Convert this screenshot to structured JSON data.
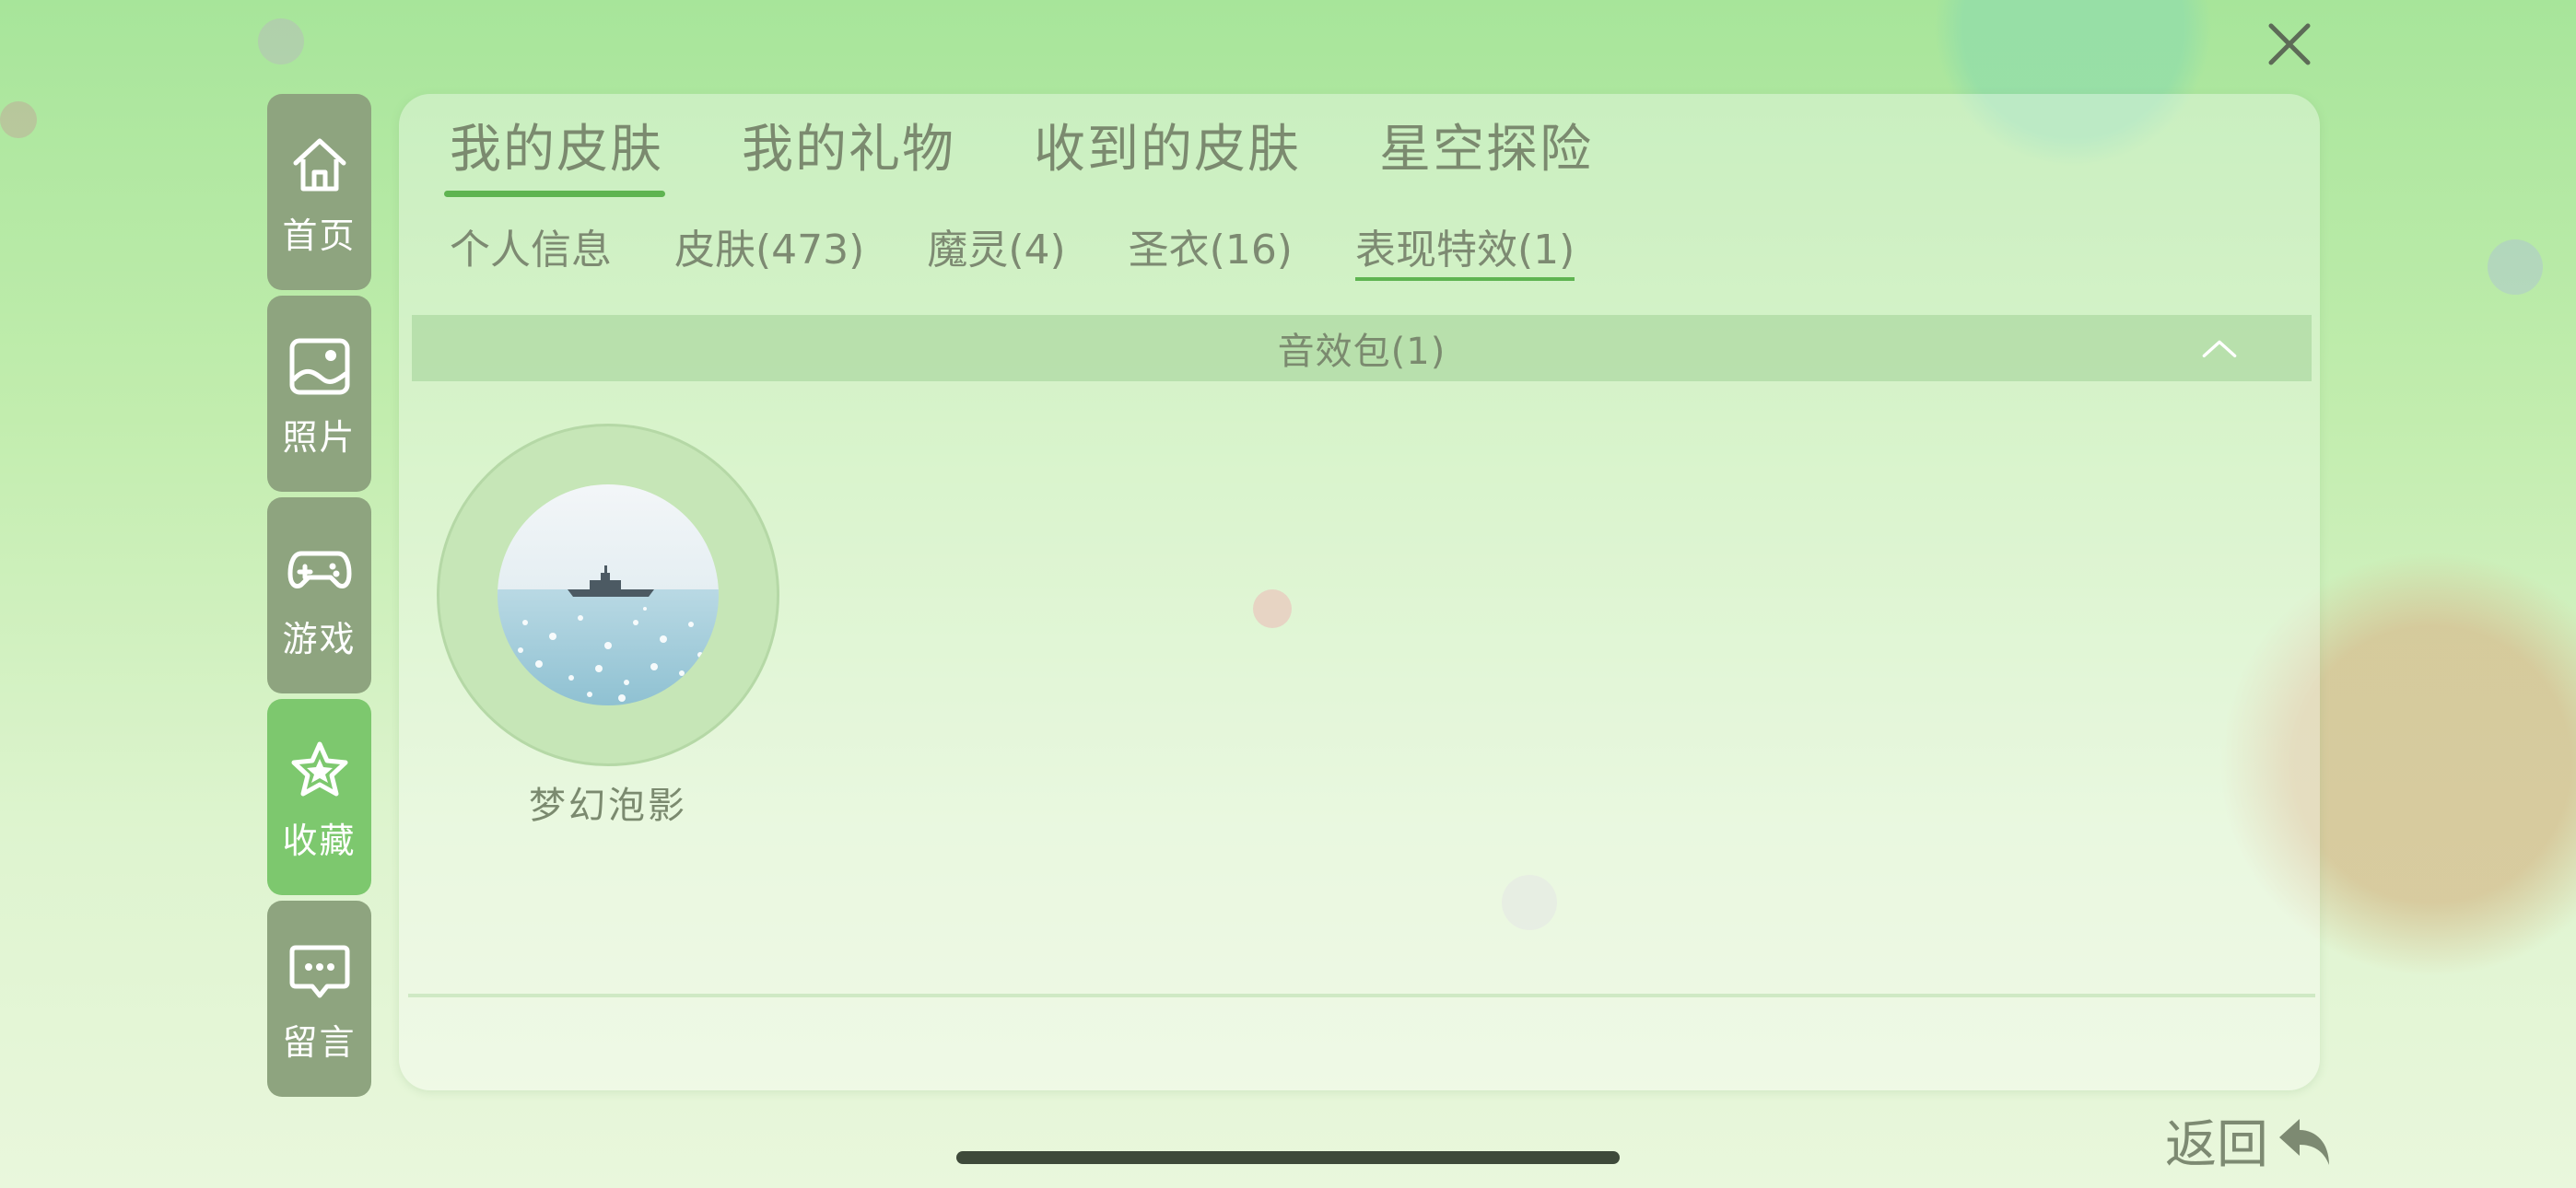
{
  "sidebar": {
    "items": [
      {
        "label": "首页",
        "icon": "home-icon"
      },
      {
        "label": "照片",
        "icon": "image-icon"
      },
      {
        "label": "游戏",
        "icon": "gamepad-icon"
      },
      {
        "label": "收藏",
        "icon": "star-icon",
        "active": true
      },
      {
        "label": "留言",
        "icon": "message-icon"
      }
    ]
  },
  "main_tabs": [
    {
      "label": "我的皮肤",
      "active": true
    },
    {
      "label": "我的礼物"
    },
    {
      "label": "收到的皮肤"
    },
    {
      "label": "星空探险"
    }
  ],
  "sub_tabs": [
    {
      "label": "个人信息"
    },
    {
      "label": "皮肤(473)"
    },
    {
      "label": "魔灵(4)"
    },
    {
      "label": "圣衣(16)"
    },
    {
      "label": "表现特效(1)",
      "active": true
    }
  ],
  "section": {
    "title": "音效包(1)",
    "items": [
      {
        "name": "梦幻泡影"
      }
    ]
  },
  "back": {
    "label": "返回"
  },
  "colors": {
    "sidebar_bg": "#8ea47f",
    "sidebar_active": "#7dc86e",
    "accent": "#5fb451",
    "text": "#7b8a6f"
  }
}
